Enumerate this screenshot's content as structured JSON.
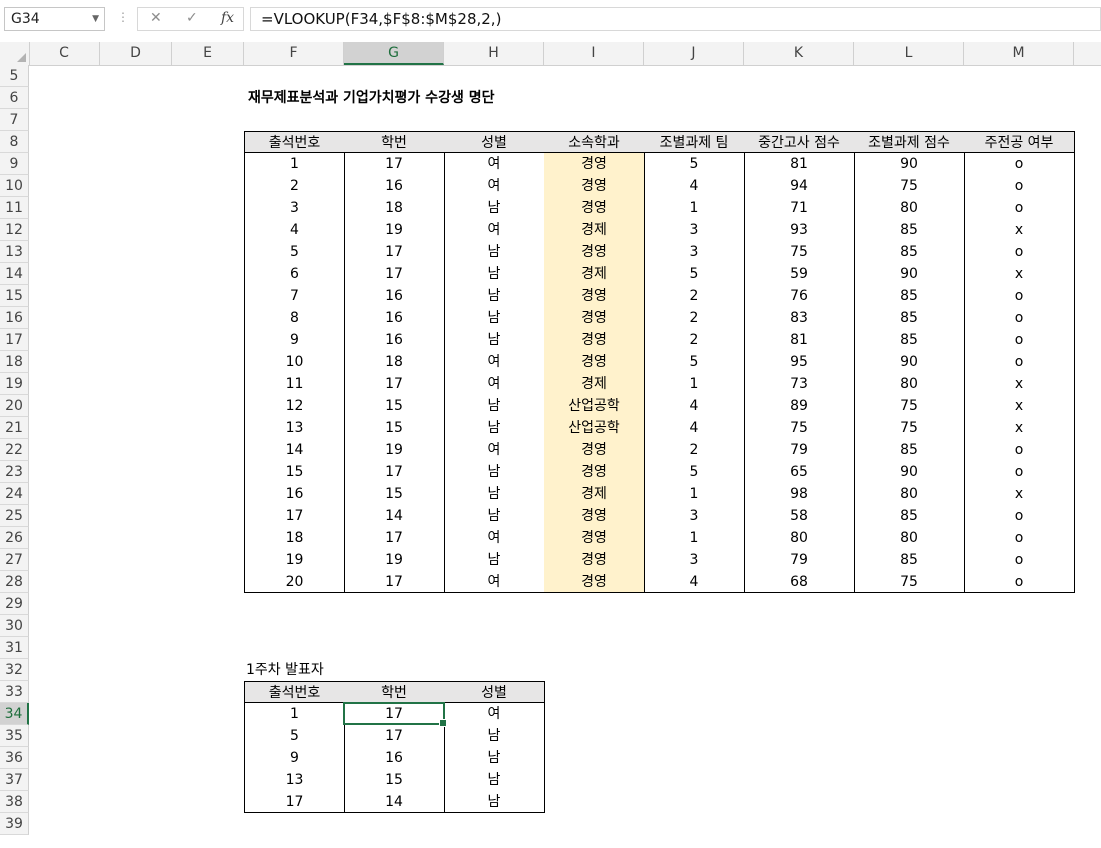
{
  "formula_bar": {
    "name_box": "G34",
    "cancel_icon": "✕",
    "enter_icon": "✓",
    "fx_label": "fx",
    "formula": "=VLOOKUP(F34,$F$8:$M$28,2,)"
  },
  "columns": [
    "C",
    "D",
    "E",
    "F",
    "G",
    "H",
    "I",
    "J",
    "K",
    "L",
    "M"
  ],
  "selected_column": "G",
  "rows": [
    "5",
    "6",
    "7",
    "8",
    "9",
    "10",
    "11",
    "12",
    "13",
    "14",
    "15",
    "16",
    "17",
    "18",
    "19",
    "20",
    "21",
    "22",
    "23",
    "24",
    "25",
    "26",
    "27",
    "28",
    "29",
    "30",
    "31",
    "32",
    "33",
    "34",
    "35",
    "36",
    "37",
    "38",
    "39"
  ],
  "selected_row": "34",
  "main_table": {
    "title": "재무제표분석과 기업가치평가 수강생 명단",
    "headers": [
      "출석번호",
      "학번",
      "성별",
      "소속학과",
      "조별과제 팀",
      "중간고사 점수",
      "조별과제 점수",
      "주전공 여부"
    ],
    "rows": [
      [
        "1",
        "17",
        "여",
        "경영",
        "5",
        "81",
        "90",
        "o"
      ],
      [
        "2",
        "16",
        "여",
        "경영",
        "4",
        "94",
        "75",
        "o"
      ],
      [
        "3",
        "18",
        "남",
        "경영",
        "1",
        "71",
        "80",
        "o"
      ],
      [
        "4",
        "19",
        "여",
        "경제",
        "3",
        "93",
        "85",
        "x"
      ],
      [
        "5",
        "17",
        "남",
        "경영",
        "3",
        "75",
        "85",
        "o"
      ],
      [
        "6",
        "17",
        "남",
        "경제",
        "5",
        "59",
        "90",
        "x"
      ],
      [
        "7",
        "16",
        "남",
        "경영",
        "2",
        "76",
        "85",
        "o"
      ],
      [
        "8",
        "16",
        "남",
        "경영",
        "2",
        "83",
        "85",
        "o"
      ],
      [
        "9",
        "16",
        "남",
        "경영",
        "2",
        "81",
        "85",
        "o"
      ],
      [
        "10",
        "18",
        "여",
        "경영",
        "5",
        "95",
        "90",
        "o"
      ],
      [
        "11",
        "17",
        "여",
        "경제",
        "1",
        "73",
        "80",
        "x"
      ],
      [
        "12",
        "15",
        "남",
        "산업공학",
        "4",
        "89",
        "75",
        "x"
      ],
      [
        "13",
        "15",
        "남",
        "산업공학",
        "4",
        "75",
        "75",
        "x"
      ],
      [
        "14",
        "19",
        "여",
        "경영",
        "2",
        "79",
        "85",
        "o"
      ],
      [
        "15",
        "17",
        "남",
        "경영",
        "5",
        "65",
        "90",
        "o"
      ],
      [
        "16",
        "15",
        "남",
        "경제",
        "1",
        "98",
        "80",
        "x"
      ],
      [
        "17",
        "14",
        "남",
        "경영",
        "3",
        "58",
        "85",
        "o"
      ],
      [
        "18",
        "17",
        "여",
        "경영",
        "1",
        "80",
        "80",
        "o"
      ],
      [
        "19",
        "19",
        "남",
        "경영",
        "3",
        "79",
        "85",
        "o"
      ],
      [
        "20",
        "17",
        "여",
        "경영",
        "4",
        "68",
        "75",
        "o"
      ]
    ]
  },
  "sub_table": {
    "title": "1주차 발표자",
    "headers": [
      "출석번호",
      "학번",
      "성별"
    ],
    "rows": [
      [
        "1",
        "17",
        "여"
      ],
      [
        "5",
        "17",
        "남"
      ],
      [
        "9",
        "16",
        "남"
      ],
      [
        "13",
        "15",
        "남"
      ],
      [
        "17",
        "14",
        "남"
      ]
    ]
  },
  "colors": {
    "highlight_column": "#fff2cc",
    "header_fill": "#e7e6e6",
    "selection": "#217346"
  }
}
